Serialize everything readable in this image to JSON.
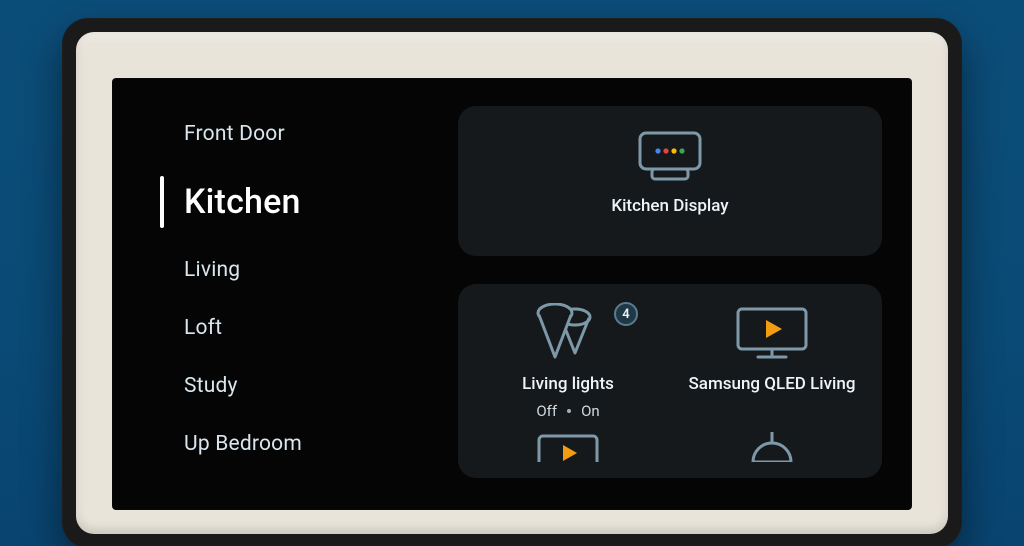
{
  "rooms": {
    "items": [
      {
        "label": "Front Door",
        "active": false
      },
      {
        "label": "Kitchen",
        "active": true
      },
      {
        "label": "Living",
        "active": false
      },
      {
        "label": "Loft",
        "active": false
      },
      {
        "label": "Study",
        "active": false
      },
      {
        "label": "Up Bedroom",
        "active": false
      }
    ]
  },
  "cards": {
    "kitchen_display": {
      "label": "Kitchen Display"
    },
    "living_lights": {
      "label": "Living lights",
      "count": "4",
      "status_off": "Off",
      "status_on": "On"
    },
    "tv": {
      "label": "Samsung QLED Living"
    }
  },
  "colors": {
    "accent_amber": "#f39c12",
    "icon_stroke": "#7d99a9",
    "card_bg": "#16191b"
  }
}
